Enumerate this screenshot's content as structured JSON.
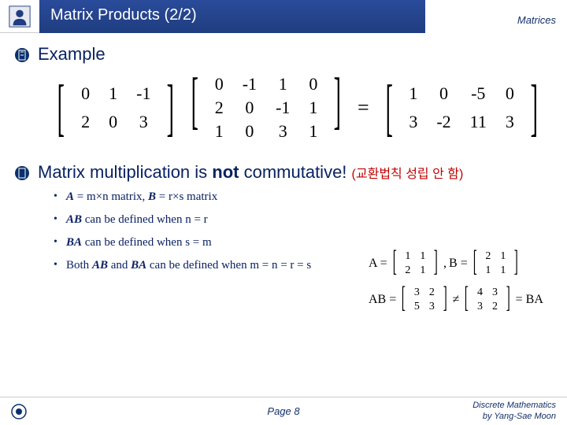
{
  "header": {
    "title": "Matrix Products (2/2)",
    "category": "Matrices"
  },
  "example": {
    "label": "Example",
    "A": [
      [
        0,
        1,
        -1
      ],
      [
        2,
        0,
        3
      ]
    ],
    "B": [
      [
        0,
        -1,
        1,
        0
      ],
      [
        2,
        0,
        -1,
        1
      ],
      [
        1,
        0,
        3,
        1
      ]
    ],
    "C": [
      [
        1,
        0,
        -5,
        0
      ],
      [
        3,
        -2,
        11,
        3
      ]
    ],
    "op": "="
  },
  "commutative": {
    "text_pre": "Matrix multiplication is ",
    "text_bold": "not",
    "text_post": " commutative!",
    "korean": "(교환법칙 성립 안 함)"
  },
  "subpoints": {
    "p1_pre": "A",
    "p1_mid1": " = m×n matrix, ",
    "p1_b": "B",
    "p1_mid2": " = r×s matrix",
    "p2_pre": "AB",
    "p2_post": " can be defined when n = r",
    "p3_pre": "BA",
    "p3_post": " can be defined when s = m",
    "p4_pre": "Both ",
    "p4_ab": "AB",
    "p4_mid": " and ",
    "p4_ba": "BA",
    "p4_post": " can be defined when m = n = r = s"
  },
  "right_math": {
    "r1_A": "A =",
    "r1_Am": [
      [
        1,
        1
      ],
      [
        2,
        1
      ]
    ],
    "r1_comma": ",",
    "r1_B": "B =",
    "r1_Bm": [
      [
        2,
        1
      ],
      [
        1,
        1
      ]
    ],
    "r2_AB": "AB =",
    "r2_ABm": [
      [
        3,
        2
      ],
      [
        5,
        3
      ]
    ],
    "r2_ne": "≠",
    "r2_BAm": [
      [
        4,
        3
      ],
      [
        3,
        2
      ]
    ],
    "r2_BA": "= BA"
  },
  "footer": {
    "page": "Page 8",
    "credit1": "Discrete Mathematics",
    "credit2": "by Yang-Sae Moon"
  },
  "chart_data": {
    "type": "table",
    "title": "Matrix product example",
    "matrices": {
      "A": [
        [
          0,
          1,
          -1
        ],
        [
          2,
          0,
          3
        ]
      ],
      "B": [
        [
          0,
          -1,
          1,
          0
        ],
        [
          2,
          0,
          -1,
          1
        ],
        [
          1,
          0,
          3,
          1
        ]
      ],
      "AB": [
        [
          1,
          0,
          -5,
          0
        ],
        [
          3,
          -2,
          11,
          3
        ]
      ]
    },
    "commutativity_example": {
      "A": [
        [
          1,
          1
        ],
        [
          2,
          1
        ]
      ],
      "B": [
        [
          2,
          1
        ],
        [
          1,
          1
        ]
      ],
      "AB": [
        [
          3,
          2
        ],
        [
          5,
          3
        ]
      ],
      "BA": [
        [
          4,
          3
        ],
        [
          3,
          2
        ]
      ]
    }
  }
}
